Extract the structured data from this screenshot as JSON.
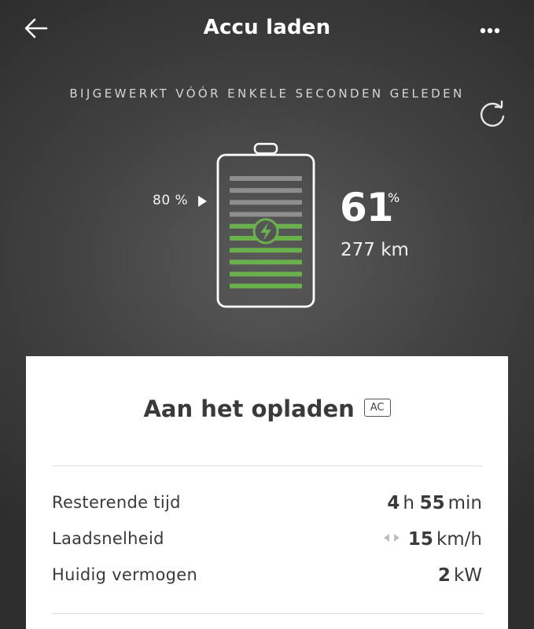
{
  "header": {
    "title": "Accu laden"
  },
  "status": {
    "updated_text": "BIJGEWERKT VÓÓR ENKELE SECONDEN GELEDEN"
  },
  "battery": {
    "charge_limit_label": "80 %",
    "charge_percent": "61",
    "percent_unit": "%",
    "range": "277 km",
    "charge_fraction": 0.61,
    "limit_fraction": 0.8,
    "colors": {
      "charged": "#6ab04c",
      "uncharged": "#8e8e8e",
      "outline": "#ffffff"
    }
  },
  "card": {
    "title": "Aan het opladen",
    "badge": "AC",
    "rows": [
      {
        "label": "Resterende tijd",
        "value1": "4",
        "unit1": "h",
        "value2": "55",
        "unit2": "min"
      },
      {
        "label": "Laadsnelheid",
        "value": "15",
        "unit": "km/h"
      },
      {
        "label": "Huidig vermogen",
        "value": "2",
        "unit": "kW"
      }
    ]
  },
  "icons": {
    "back": "arrow-left-icon",
    "more": "more-dots-icon",
    "refresh": "refresh-icon",
    "bolt": "lightning-bolt-icon",
    "speed": "left-right-arrows-icon"
  }
}
